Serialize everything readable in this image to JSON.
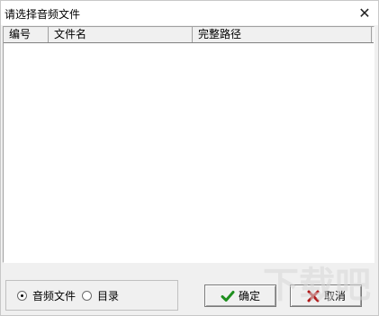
{
  "window": {
    "title": "请选择音频文件",
    "close_glyph": "✕"
  },
  "list": {
    "columns": [
      "编号",
      "文件名",
      "完整路径"
    ],
    "rows": []
  },
  "options": {
    "radio_1": {
      "label": "音频文件",
      "checked": true
    },
    "radio_2": {
      "label": "目录",
      "checked": false
    }
  },
  "buttons": {
    "ok_label": "确定",
    "cancel_label": "取消",
    "ok_icon": "check-icon",
    "cancel_icon": "x-icon",
    "ok_icon_color": "#1f8f1f",
    "cancel_icon_color": "#b01818"
  },
  "watermark": {
    "text": "下载吧"
  }
}
